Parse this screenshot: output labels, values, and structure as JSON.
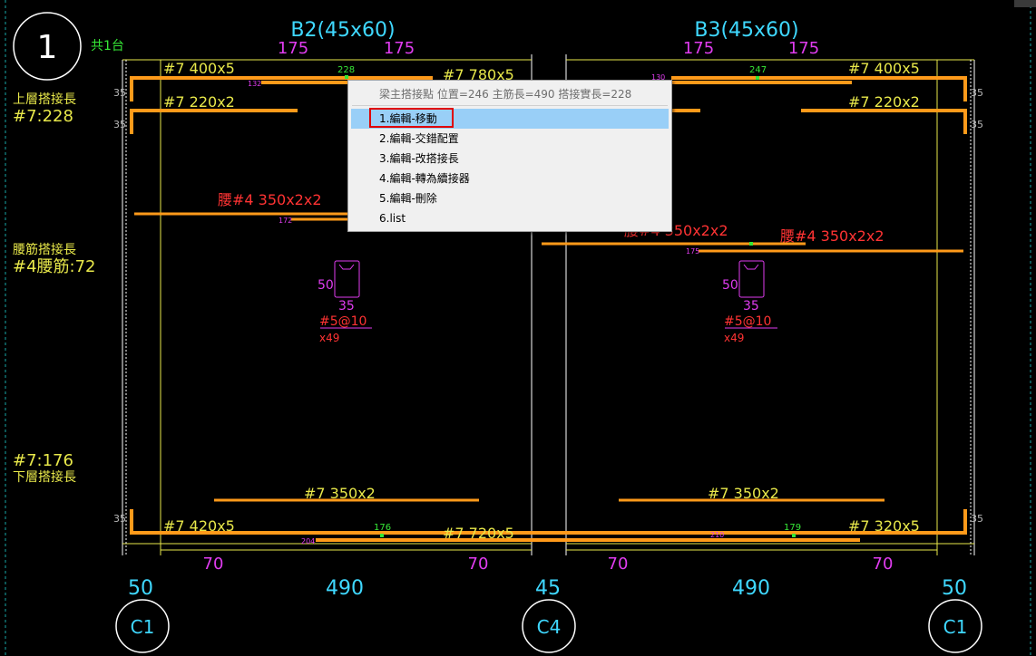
{
  "colors": {
    "cyan": "#3fd8ff",
    "yellow": "#e8e84a",
    "magenta": "#e03cf0",
    "red": "#ff3333",
    "orange": "#ff9a1a",
    "green": "#36e836",
    "white": "#ffffff",
    "dashline": "#18a8a8",
    "gray": "#b8b8b8"
  },
  "drawing": {
    "circle_label": "1",
    "circle_note": "共1台",
    "left_notes": {
      "top_lap_title": "上層搭接長",
      "top_lap_value": "#7:228",
      "web_lap_title": "腰筋搭接長",
      "web_lap_value": "#4腰筋:72",
      "bottom_lap_value": "#7:176",
      "bottom_lap_title": "下層搭接長"
    },
    "beams": [
      {
        "name": "B2(45x60)",
        "dim_top_left": "175",
        "dim_top_right": "175",
        "top_bar1": "#7 400x5",
        "top_bar2": "#7 220x2",
        "top_bar_right": "#7 780x5",
        "top_splice": "228",
        "top_splice_small": "132",
        "web_bar": "腰#4 350x2x2",
        "web_small": "172",
        "section_h": "50",
        "section_w": "35",
        "stirrup": "#5@10",
        "stirrup_count": "x49",
        "bottom_bar_mid": "#7 350x2",
        "bottom_bar1": "#7 420x5",
        "bottom_bar_right": "#7 720x5",
        "bottom_splice": "176",
        "bottom_small": "204",
        "dim_bot_left": "70",
        "dim_bot_right": "70",
        "span": "490"
      },
      {
        "name": "B3(45x60)",
        "dim_top_left": "175",
        "dim_top_right": "175",
        "top_bar1": "#7 400x5",
        "top_bar2": "#7 220x2",
        "top_splice": "247",
        "top_splice_small": "130",
        "web_bar_left": "腰#4 350x2x2",
        "web_bar": "腰#4 350x2x2",
        "web_small": "175",
        "section_h": "50",
        "section_w": "35",
        "stirrup": "#5@10",
        "stirrup_count": "x49",
        "bottom_bar_mid": "#7 350x2",
        "bottom_bar1": "#7 320x5",
        "bottom_splice": "179",
        "bottom_small": "210",
        "dim_bot_left": "70",
        "dim_bot_right": "70",
        "span": "490"
      }
    ],
    "cover_labels": [
      "35",
      "35",
      "35",
      "35",
      "35",
      "35"
    ],
    "columns": [
      {
        "name": "C1",
        "width": "50"
      },
      {
        "name": "C4",
        "width": "45"
      },
      {
        "name": "C1",
        "width": "50"
      }
    ]
  },
  "context_menu": {
    "title": "梁主搭接點 位置=246 主筋長=490 搭接實長=228",
    "items": [
      {
        "label": "1.編輯-移動",
        "selected": true
      },
      {
        "label": "2.編輯-交錯配置",
        "selected": false
      },
      {
        "label": "3.編輯-改搭接長",
        "selected": false
      },
      {
        "label": "4.編輯-轉為續接器",
        "selected": false
      },
      {
        "label": "5.編輯-刪除",
        "selected": false
      },
      {
        "label": "6.list",
        "selected": false
      }
    ]
  }
}
